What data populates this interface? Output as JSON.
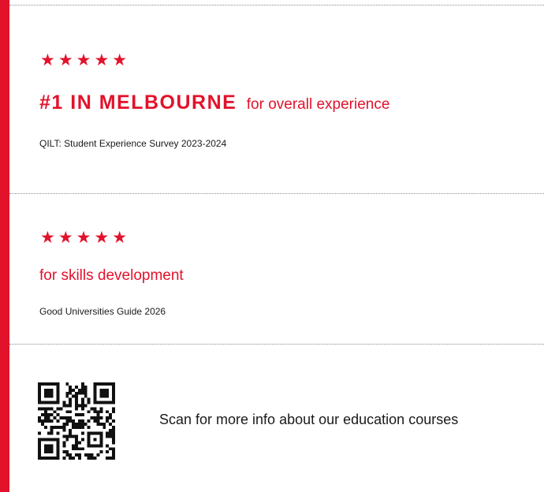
{
  "accent_color": "#e3122b",
  "award_1": {
    "rating": 5,
    "stars": "★★★★★",
    "headline": "#1 IN MELBOURNE",
    "qualifier": "for overall experience",
    "source": "QILT: Student Experience Survey 2023-2024"
  },
  "award_2": {
    "rating": 5,
    "stars": "★★★★★",
    "qualifier": "for skills development",
    "source": "Good Universities Guide 2026"
  },
  "qr": {
    "icon": "qr-code-icon",
    "caption": "Scan for more info about our education courses"
  }
}
